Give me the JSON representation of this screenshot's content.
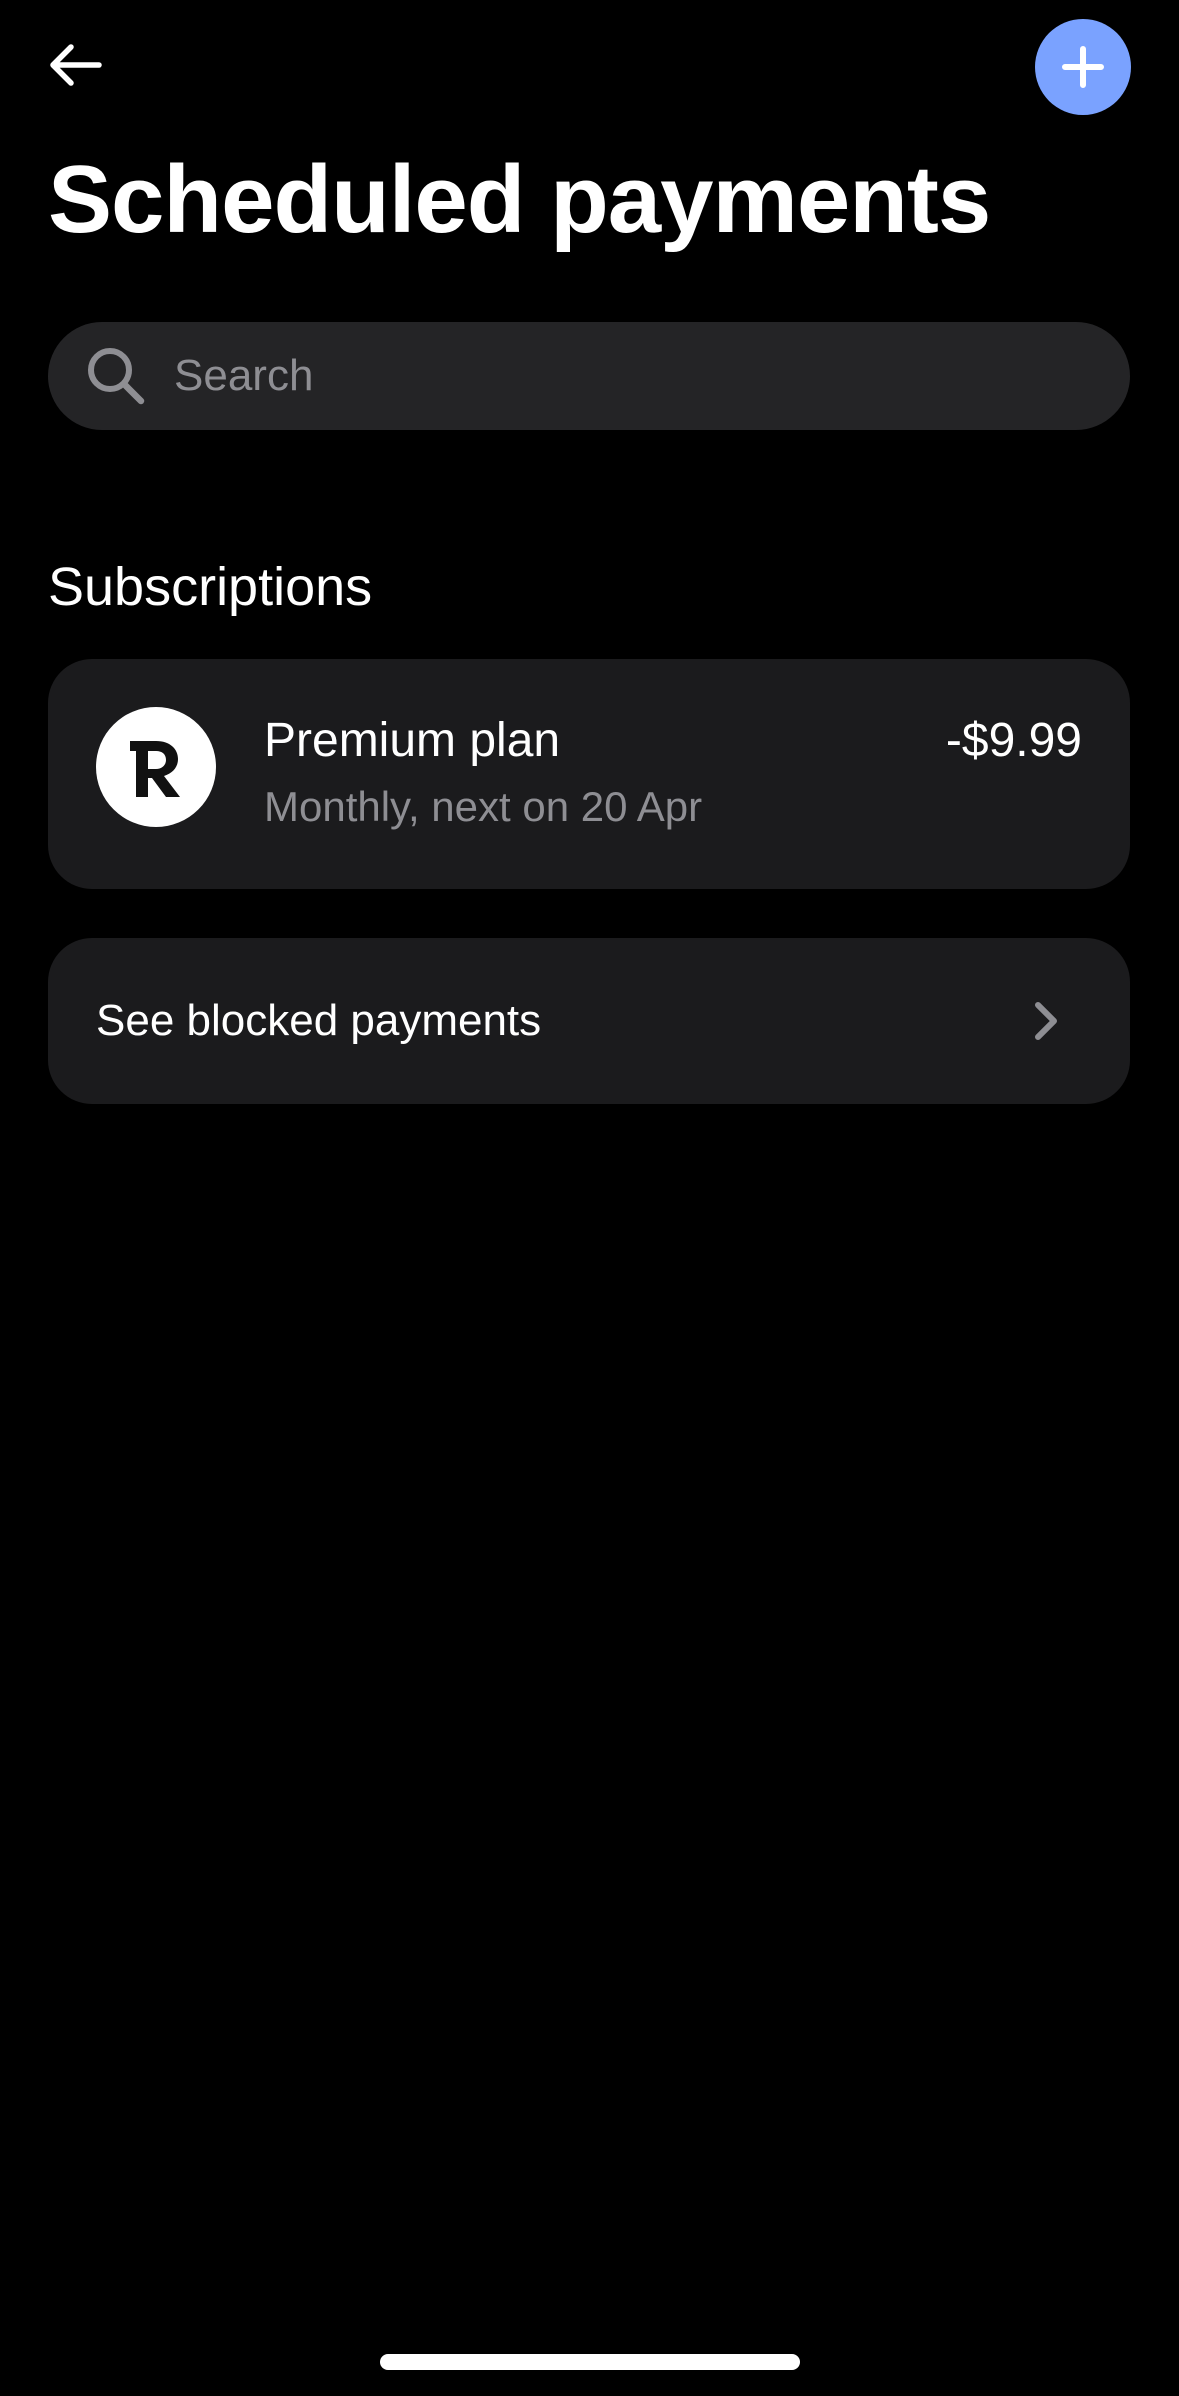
{
  "header": {
    "title": "Scheduled payments",
    "back_icon": "arrow-left-icon",
    "add_icon": "plus-icon",
    "accent_color": "#7aa2ff"
  },
  "search": {
    "placeholder": "Search",
    "value": "",
    "icon": "search-icon"
  },
  "subscriptions": {
    "section_title": "Subscriptions",
    "items": [
      {
        "merchant_logo": "revolut-r-logo",
        "name": "Premium plan",
        "schedule": "Monthly, next on 20 Apr",
        "amount": "-$9.99"
      }
    ]
  },
  "blocked": {
    "label": "See blocked payments",
    "icon": "chevron-right-icon"
  },
  "colors": {
    "background": "#000000",
    "card": "#1b1b1d",
    "search_bg": "#242426",
    "secondary_text": "#8e8e93"
  }
}
